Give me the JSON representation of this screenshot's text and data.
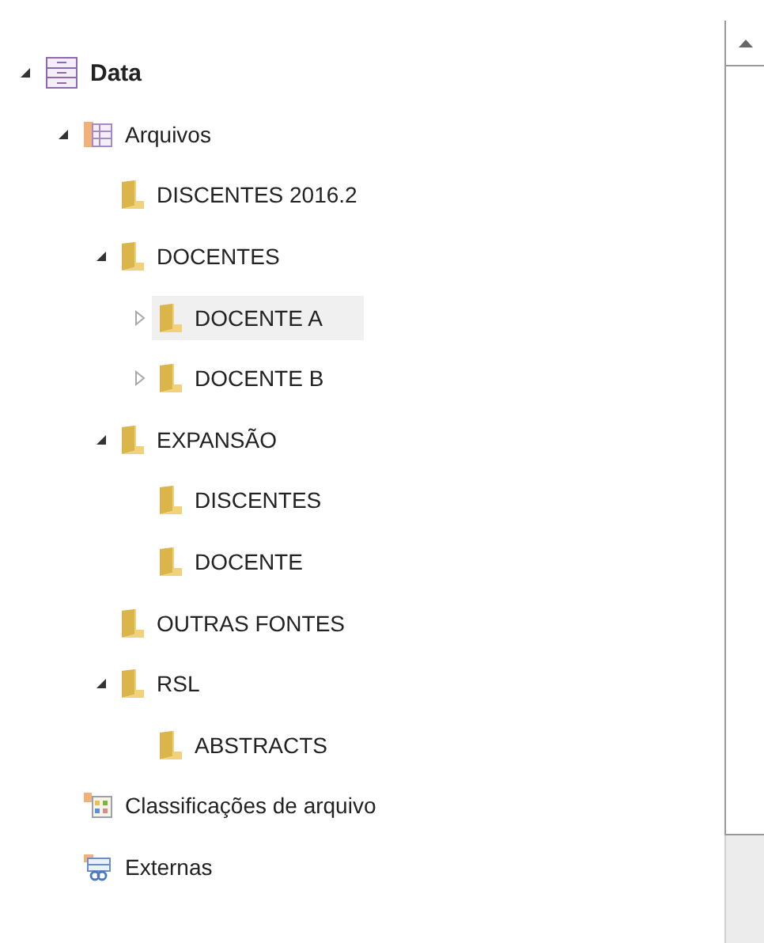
{
  "tree": [
    {
      "label": "Data",
      "kind": "database",
      "expanded": true,
      "selected": false,
      "children": [
        {
          "label": "Arquivos",
          "kind": "table-group",
          "expanded": true,
          "selected": false,
          "children": [
            {
              "label": "DISCENTES 2016.2",
              "kind": "folder",
              "selected": false
            },
            {
              "label": "DOCENTES",
              "kind": "folder",
              "expanded": true,
              "selected": false,
              "children": [
                {
                  "label": "DOCENTE A",
                  "kind": "folder",
                  "expanded": false,
                  "selected": true
                },
                {
                  "label": "DOCENTE B",
                  "kind": "folder",
                  "expanded": false,
                  "selected": false
                }
              ]
            },
            {
              "label": "EXPANSÃO",
              "kind": "folder",
              "expanded": true,
              "selected": false,
              "children": [
                {
                  "label": "DISCENTES",
                  "kind": "folder",
                  "selected": false
                },
                {
                  "label": "DOCENTE",
                  "kind": "folder",
                  "selected": false
                }
              ]
            },
            {
              "label": "OUTRAS FONTES",
              "kind": "folder",
              "selected": false
            },
            {
              "label": "RSL",
              "kind": "folder",
              "expanded": true,
              "selected": false,
              "children": [
                {
                  "label": "ABSTRACTS",
                  "kind": "folder",
                  "selected": false
                }
              ]
            }
          ]
        },
        {
          "label": "Classificações de arquivo",
          "kind": "classification",
          "selected": false
        },
        {
          "label": "Externas",
          "kind": "external",
          "selected": false
        }
      ]
    }
  ]
}
